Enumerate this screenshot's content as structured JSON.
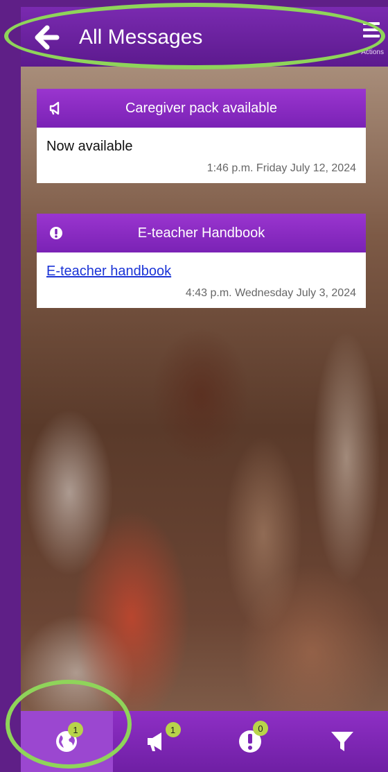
{
  "header": {
    "title": "All Messages",
    "back_icon": "arrow-left-icon",
    "actions_icon": "hamburger-menu-icon",
    "actions_label": "Actions"
  },
  "messages": [
    {
      "category_icon": "megaphone-icon",
      "title": "Caregiver pack available",
      "body": "Now available",
      "body_is_link": false,
      "timestamp": "1:46 p.m. Friday July 12, 2024"
    },
    {
      "category_icon": "exclamation-icon",
      "title": "E-teacher Handbook",
      "body": "E-teacher handbook",
      "body_is_link": true,
      "timestamp": "4:43 p.m. Wednesday July 3, 2024"
    }
  ],
  "bottom_nav": {
    "tabs": [
      {
        "icon": "globe-icon",
        "badge": "1",
        "active": true
      },
      {
        "icon": "megaphone-icon",
        "badge": "1",
        "active": false
      },
      {
        "icon": "exclamation-icon",
        "badge": "0",
        "active": false
      },
      {
        "icon": "filter-icon",
        "badge": null,
        "active": false
      }
    ]
  },
  "colors": {
    "primary": "#7a22b5",
    "background": "#5f1f87",
    "badge": "#b8d44a",
    "highlight": "#8fd45a",
    "link": "#1a33d6"
  }
}
